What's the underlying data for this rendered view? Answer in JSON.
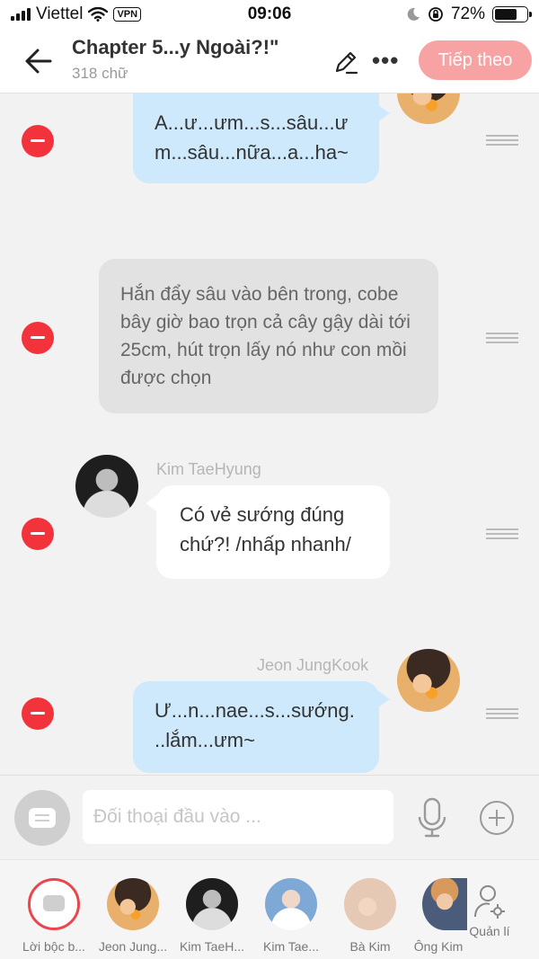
{
  "status_bar": {
    "carrier": "Viettel",
    "vpn": "VPN",
    "time": "09:06",
    "battery": "72%",
    "battery_level": 0.72
  },
  "header": {
    "title": "Chapter 5...y Ngoài?!\"",
    "subtitle": "318 chữ",
    "next_label": "Tiếp theo",
    "next_color": "#f7a2a3"
  },
  "messages": [
    {
      "type": "outgoing",
      "text": "A...ư...ưm...s...sâu...ư m...sâu...nữa...a...ha~"
    },
    {
      "type": "narration",
      "text": "Hắn đẩy sâu vào bên trong, cobe bây giờ bao trọn cả cây gậy dài tới 25cm, hút trọn lấy nó như con mồi được chọn"
    },
    {
      "type": "incoming",
      "sender": "Kim TaeHyung",
      "text": "Có vẻ sướng đúng chứ?! /nhấp nhanh/"
    },
    {
      "type": "outgoing",
      "sender": "Jeon JungKook",
      "text": "Ư...n...nae...s...sướng. ..lắm...ưm~"
    }
  ],
  "input": {
    "placeholder": "Đối thoại đầu vào ..."
  },
  "characters": [
    {
      "label": "Lời bộc b...",
      "icon": "narrator-icon"
    },
    {
      "label": "Jeon Jung..."
    },
    {
      "label": "Kim TaeH..."
    },
    {
      "label": "Kim Tae..."
    },
    {
      "label": "Bà Kim"
    },
    {
      "label": "Ông Kim"
    }
  ],
  "manage_label": "Quản lí",
  "colors": {
    "delete": "#f2333b",
    "outgoing_bubble": "#cde9fb",
    "narration_bubble": "#e2e2e2",
    "incoming_bubble": "#ffffff",
    "selected_character_ring": "#e9464e"
  }
}
